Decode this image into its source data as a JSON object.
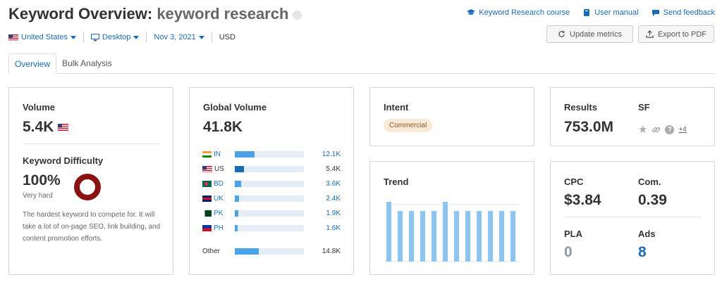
{
  "header": {
    "title_prefix": "Keyword Overview:",
    "keyword": "keyword research",
    "links": {
      "course": "Keyword Research course",
      "manual": "User manual",
      "feedback": "Send feedback"
    }
  },
  "filters": {
    "country": "United States",
    "device": "Desktop",
    "date": "Nov 3, 2021",
    "currency": "USD"
  },
  "buttons": {
    "update": "Update metrics",
    "export": "Export to PDF"
  },
  "tabs": [
    "Overview",
    "Bulk Analysis"
  ],
  "volume": {
    "label": "Volume",
    "value": "5.4K"
  },
  "difficulty": {
    "label": "Keyword Difficulty",
    "value": "100%",
    "level": "Very hard",
    "percent": 100,
    "description": "The hardest keyword to compete for. It will take a lot of on-page SEO, link building, and content promotion efforts."
  },
  "global": {
    "label": "Global Volume",
    "value": "41.8K",
    "rows": [
      {
        "code": "IN",
        "value": "12.1K",
        "share": 0.29
      },
      {
        "code": "US",
        "value": "5.4K",
        "share": 0.13
      },
      {
        "code": "BD",
        "value": "3.6K",
        "share": 0.09
      },
      {
        "code": "UK",
        "value": "2.4K",
        "share": 0.06
      },
      {
        "code": "PK",
        "value": "1.9K",
        "share": 0.05
      },
      {
        "code": "PH",
        "value": "1.6K",
        "share": 0.04
      }
    ],
    "other": {
      "label": "Other",
      "value": "14.8K",
      "share": 0.35
    }
  },
  "intent": {
    "label": "Intent",
    "value": "Commercial"
  },
  "trend": {
    "label": "Trend",
    "values": [
      0.85,
      0.72,
      0.72,
      0.72,
      0.72,
      0.85,
      0.72,
      0.72,
      0.72,
      0.72,
      0.72,
      0.72
    ]
  },
  "results": {
    "label": "Results",
    "value": "753.0M"
  },
  "sf": {
    "label": "SF",
    "more": "+4"
  },
  "cpc": {
    "label": "CPC",
    "value": "$3.84"
  },
  "com": {
    "label": "Com.",
    "value": "0.39"
  },
  "pla": {
    "label": "PLA",
    "value": "0"
  },
  "ads": {
    "label": "Ads",
    "value": "8"
  },
  "colors": {
    "accent": "#1a6db4",
    "bar": "#4aa3e6",
    "trend": "#8ec4ef",
    "kd_ring": "#8b1212"
  }
}
